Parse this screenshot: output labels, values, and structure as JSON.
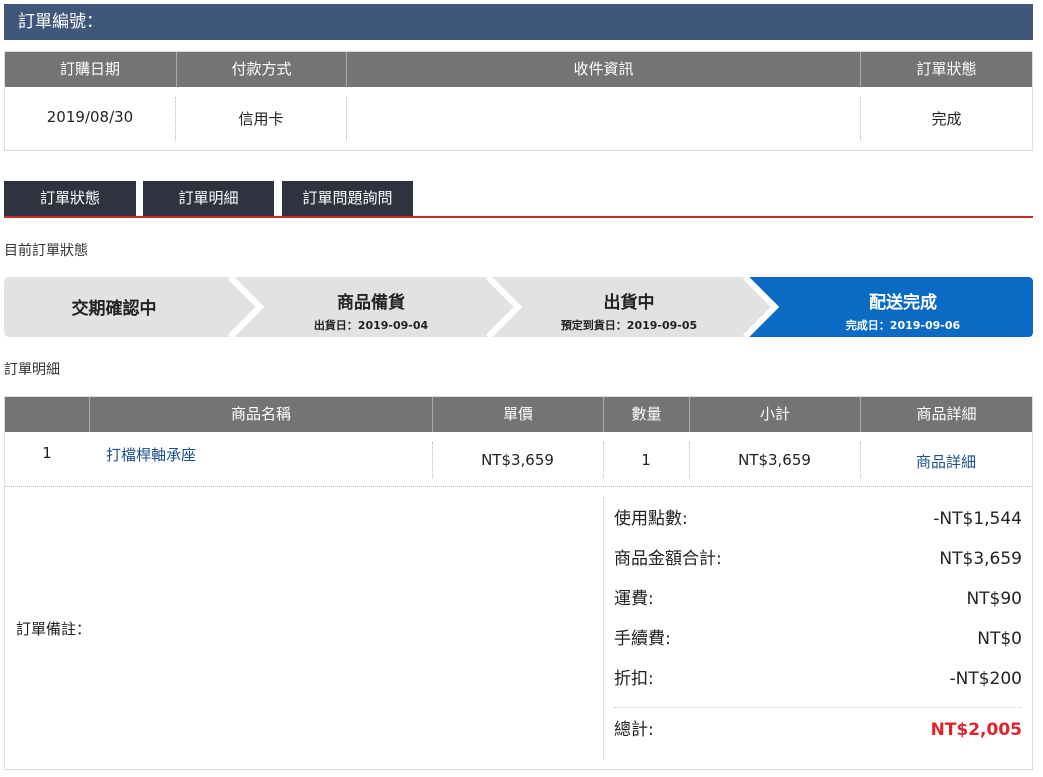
{
  "order_header": {
    "title": "訂單編號："
  },
  "order_info": {
    "headers": [
      "訂購日期",
      "付款方式",
      "收件資訊",
      "訂單狀態"
    ],
    "values": [
      "2019/08/30",
      "信用卡",
      "",
      "完成"
    ]
  },
  "tabs": [
    {
      "label": "訂單狀態"
    },
    {
      "label": "訂單明細"
    },
    {
      "label": "訂單問題詢問"
    }
  ],
  "status_section": {
    "label": "目前訂單狀態",
    "steps": [
      {
        "title": "交期確認中",
        "sub": ""
      },
      {
        "title": "商品備貨",
        "sub": "出貨日：2019-09-04"
      },
      {
        "title": "出貨中",
        "sub": "預定到貨日：2019-09-05"
      },
      {
        "title": "配送完成",
        "sub": "完成日：2019-09-06"
      }
    ],
    "active_color": "#0a6ac4"
  },
  "detail_section": {
    "label": "訂單明細",
    "headers": [
      "",
      "商品名稱",
      "單價",
      "數量",
      "小計",
      "商品詳細"
    ],
    "rows": [
      {
        "index": "1",
        "name": "打檔桿軸承座",
        "price": "NT$3,659",
        "qty": "1",
        "subtotal": "NT$3,659",
        "detail_link": "商品詳細"
      }
    ]
  },
  "remarks": {
    "label": "訂單備註："
  },
  "summary": {
    "points": {
      "label": "使用點數:",
      "value": "-NT$1,544"
    },
    "goods_total": {
      "label": "商品金額合計:",
      "value": "NT$3,659"
    },
    "shipping": {
      "label": "運費:",
      "value": "NT$90"
    },
    "fee": {
      "label": "手續費:",
      "value": "NT$0"
    },
    "discount": {
      "label": "折扣:",
      "value": "-NT$200"
    },
    "total": {
      "label": "總計:",
      "value": "NT$2,005",
      "color": "#e0232b"
    }
  },
  "colors": {
    "link": "#1d4f8c",
    "header_bg": "#3e577a",
    "table_head": "#747474",
    "tab_bg": "#2f3340",
    "tab_underline": "#d42a2a"
  }
}
